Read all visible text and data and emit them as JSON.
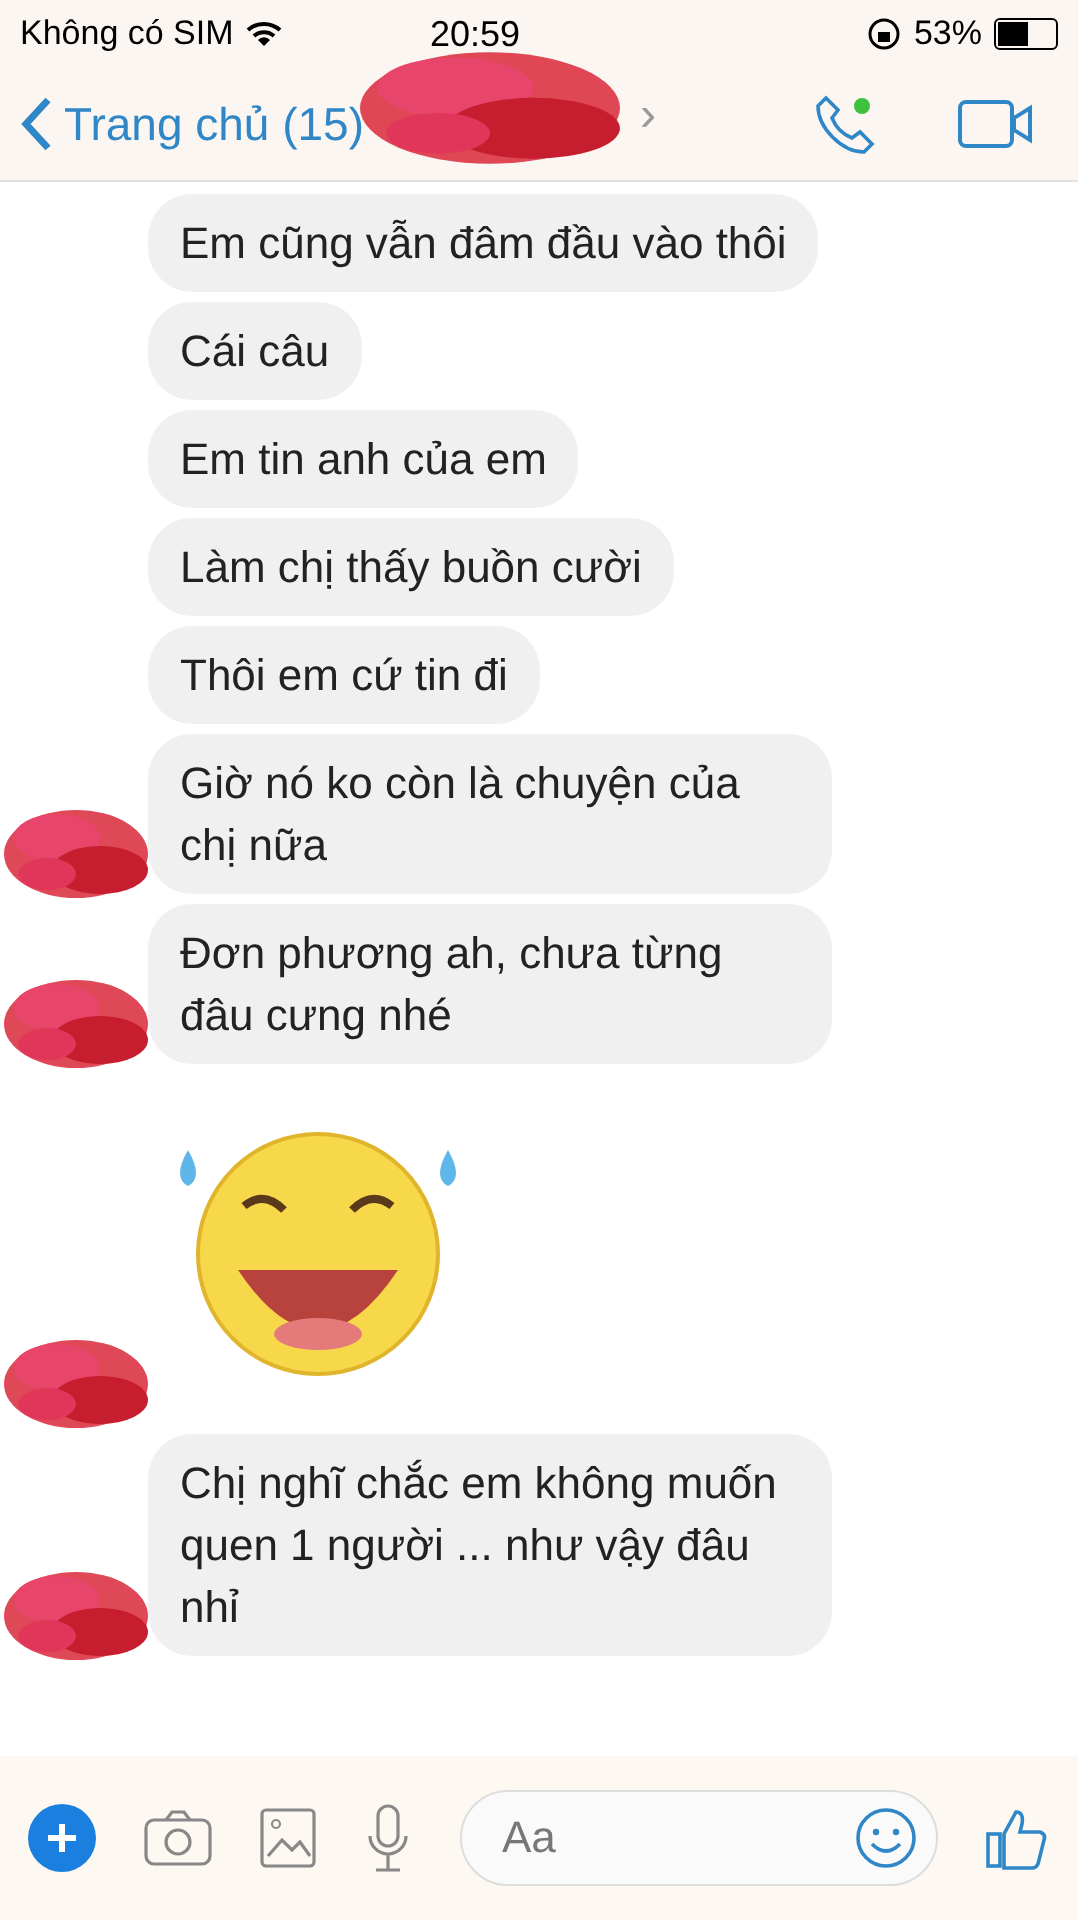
{
  "status_bar": {
    "carrier": "Không có SIM",
    "time": "20:59",
    "battery_percent": "53%"
  },
  "header": {
    "back_label": "Trang chủ (15)",
    "title_chevron": "›"
  },
  "messages": [
    {
      "kind": "text",
      "text": "Em cũng vẫn đâm đầu vào thôi",
      "avatar": false
    },
    {
      "kind": "text",
      "text": "Cái câu",
      "avatar": false
    },
    {
      "kind": "text",
      "text": "Em tin anh của em",
      "avatar": false
    },
    {
      "kind": "text",
      "text": "Làm chị thấy buồn cười",
      "avatar": false
    },
    {
      "kind": "text",
      "text": "Thôi em cứ tin đi",
      "avatar": false
    },
    {
      "kind": "text",
      "text": "Giờ nó ko còn là chuyện của chị nữa",
      "avatar": true
    },
    {
      "kind": "text",
      "text": "Đơn phương ah, chưa từng đâu cưng nhé",
      "avatar": true
    },
    {
      "kind": "sticker",
      "avatar": true
    },
    {
      "kind": "text",
      "text": "Chị nghĩ chắc em không muốn quen 1 người ... như vậy đâu nhỉ",
      "avatar": true
    }
  ],
  "composer": {
    "placeholder": "Aa"
  }
}
